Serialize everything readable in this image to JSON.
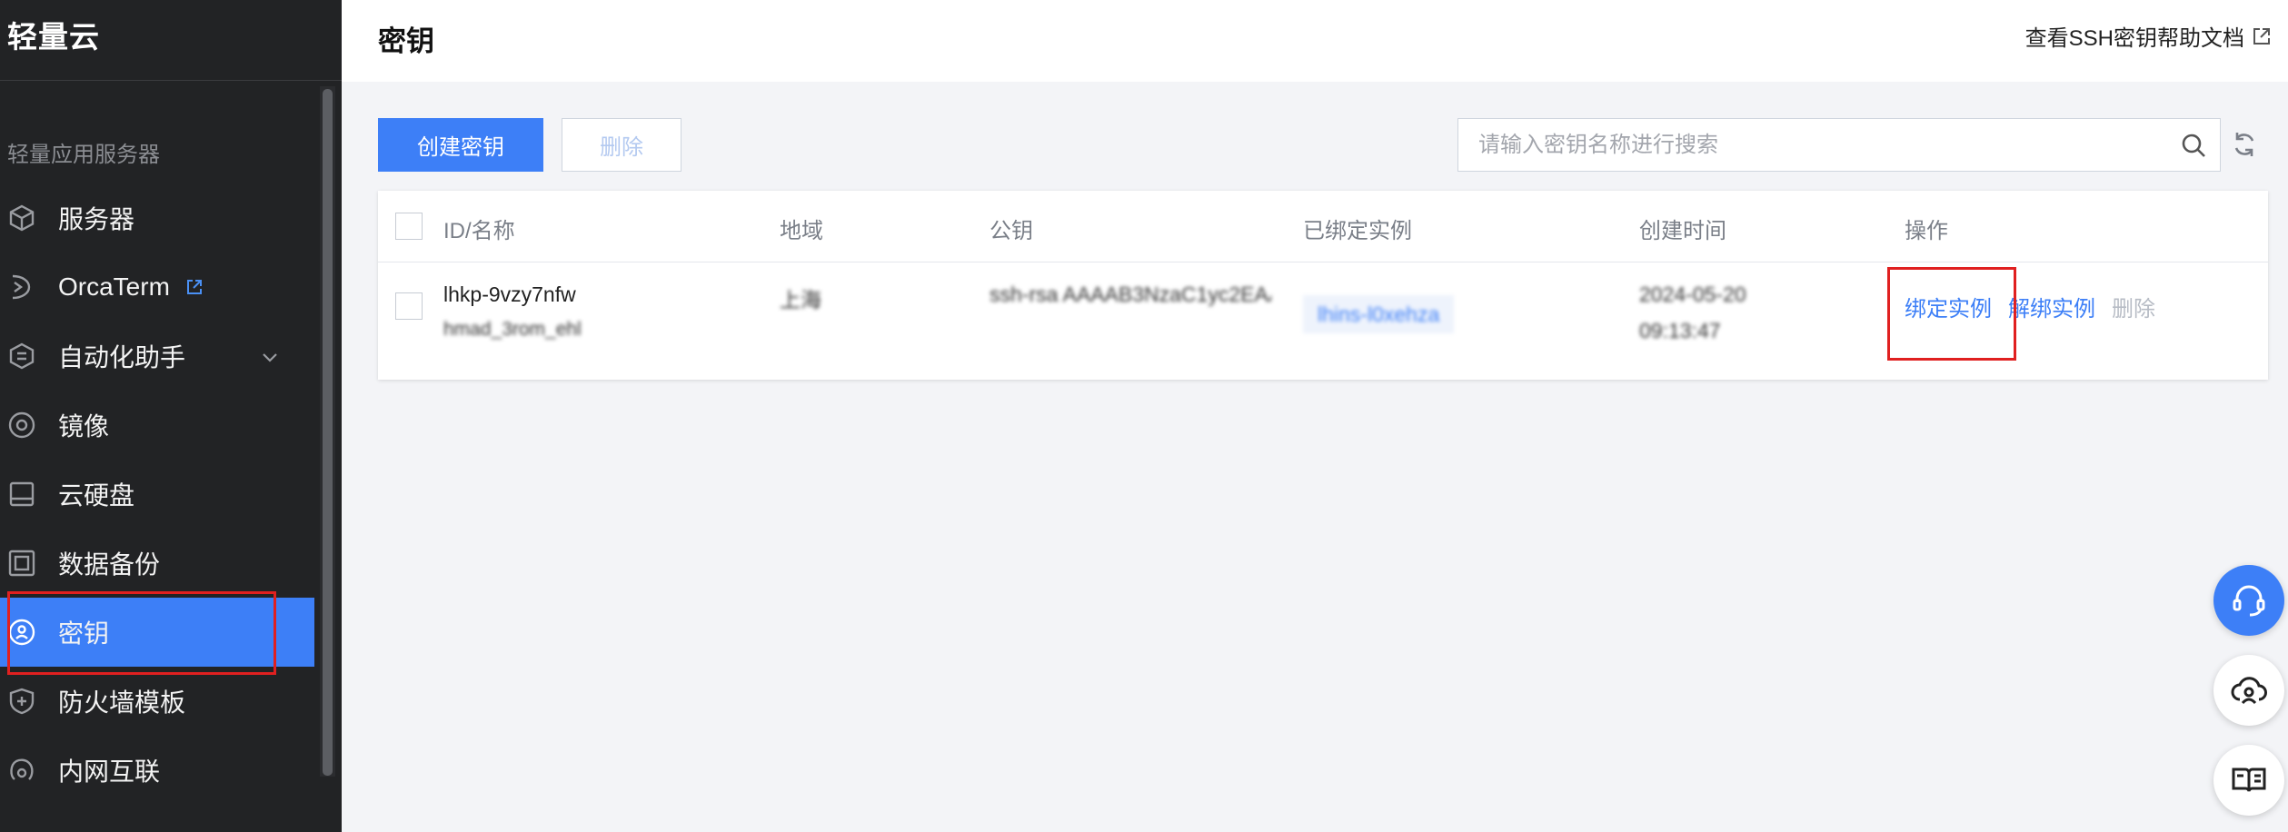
{
  "sidebar": {
    "brand": "轻量云",
    "section_title": "轻量应用服务器",
    "items": [
      {
        "label": "服务器",
        "icon": "cube-icon"
      },
      {
        "label": "OrcaTerm",
        "icon": "terminal-icon",
        "external": true
      },
      {
        "label": "自动化助手",
        "icon": "automation-icon",
        "expandable": true
      },
      {
        "label": "镜像",
        "icon": "disc-icon"
      },
      {
        "label": "云硬盘",
        "icon": "disk-icon"
      },
      {
        "label": "数据备份",
        "icon": "backup-icon"
      },
      {
        "label": "密钥",
        "icon": "key-icon",
        "active": true
      },
      {
        "label": "防火墙模板",
        "icon": "shield-icon"
      },
      {
        "label": "内网互联",
        "icon": "network-icon"
      }
    ]
  },
  "header": {
    "title": "密钥",
    "help_link": "查看SSH密钥帮助文档"
  },
  "toolbar": {
    "create_label": "创建密钥",
    "delete_label": "删除",
    "search_placeholder": "请输入密钥名称进行搜索"
  },
  "table": {
    "columns": [
      "ID/名称",
      "地域",
      "公钥",
      "已绑定实例",
      "创建时间",
      "操作"
    ],
    "rows": [
      {
        "id": "lhkp-9vzy7nfw",
        "name": "hmad_3rom_ehl",
        "region": "上海",
        "public_key": "ssh-rsa AAAAB3NzaC1yc2EAA...",
        "bound_instance": "lhins-l0xehza",
        "created_date": "2024-05-20",
        "created_time": "09:13:47",
        "actions": {
          "bind": "绑定实例",
          "unbind": "解绑实例",
          "delete": "删除"
        }
      }
    ]
  },
  "colors": {
    "accent": "#3d7ff7",
    "sidebar_bg": "#222325",
    "highlight": "#e02020"
  }
}
